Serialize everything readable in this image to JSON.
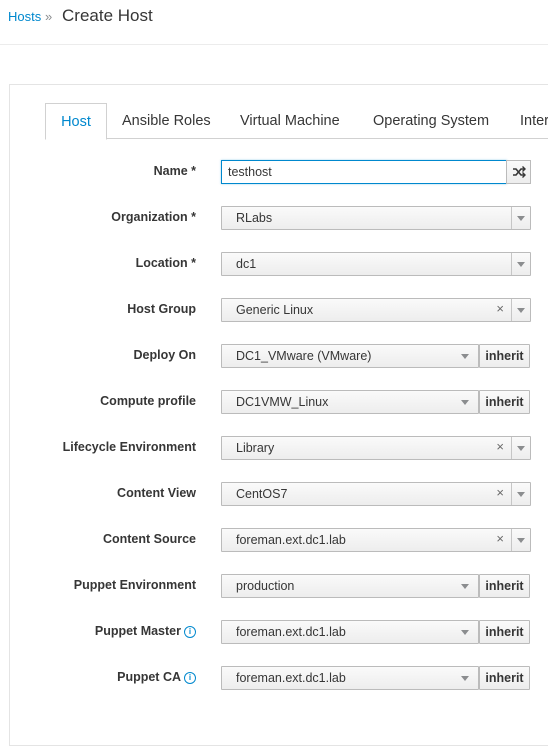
{
  "breadcrumb": {
    "parent": "Hosts",
    "separator": "»",
    "current": "Create Host"
  },
  "tabs": [
    {
      "label": "Host",
      "active": true
    },
    {
      "label": "Ansible Roles",
      "active": false
    },
    {
      "label": "Virtual Machine",
      "active": false
    },
    {
      "label": "Operating System",
      "active": false
    },
    {
      "label": "Inter",
      "active": false
    }
  ],
  "form": {
    "name": {
      "label": "Name *",
      "value": "testhost"
    },
    "organization": {
      "label": "Organization *",
      "value": "RLabs"
    },
    "location": {
      "label": "Location *",
      "value": "dc1"
    },
    "host_group": {
      "label": "Host Group",
      "value": "Generic Linux"
    },
    "deploy_on": {
      "label": "Deploy On",
      "value": "DC1_VMware (VMware)"
    },
    "compute_profile": {
      "label": "Compute profile",
      "value": "DC1VMW_Linux"
    },
    "lifecycle_environment": {
      "label": "Lifecycle Environment",
      "value": "Library"
    },
    "content_view": {
      "label": "Content View",
      "value": "CentOS7"
    },
    "content_source": {
      "label": "Content Source",
      "value": "foreman.ext.dc1.lab"
    },
    "puppet_environment": {
      "label": "Puppet Environment",
      "value": "production"
    },
    "puppet_master": {
      "label": "Puppet Master",
      "value": "foreman.ext.dc1.lab"
    },
    "puppet_ca": {
      "label": "Puppet CA",
      "value": "foreman.ext.dc1.lab"
    },
    "inherit_label": "inherit",
    "clear_symbol": "×",
    "info_symbol": "i"
  },
  "colors": {
    "link": "#0088ce",
    "text": "#363636",
    "border": "#bbbbbb"
  },
  "icons": {
    "shuffle": "random-icon",
    "info": "info-circle-icon",
    "caret": "caret-down-icon",
    "clear": "clear-icon"
  }
}
